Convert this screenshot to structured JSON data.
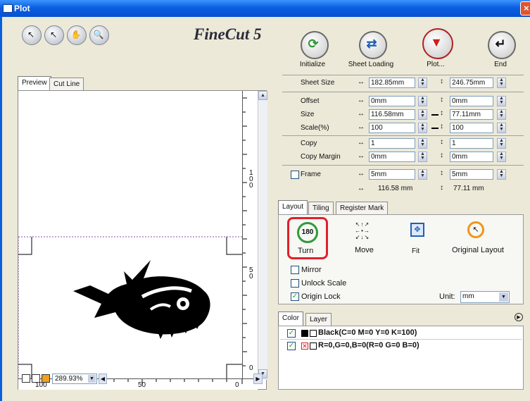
{
  "window": {
    "title": "Plot",
    "close": "×"
  },
  "toolbar": {
    "tools": [
      {
        "name": "select-tool",
        "glyph": "↖"
      },
      {
        "name": "pointer-tool",
        "glyph": "↖"
      },
      {
        "name": "hand-tool",
        "glyph": "✋"
      },
      {
        "name": "zoom-tool",
        "glyph": "🔍"
      }
    ],
    "logo": "FineCut 5"
  },
  "actions": {
    "initialize": "Initialize",
    "sheet_loading": "Sheet Loading",
    "plot": "Plot...",
    "end": "End"
  },
  "preview_tabs": [
    "Preview",
    "Cut Line"
  ],
  "rulers": {
    "right_marks": [
      "1",
      "0",
      "0",
      "5",
      "0",
      "0"
    ],
    "bottom_marks": [
      "100",
      "50",
      "0"
    ]
  },
  "zoom": "289.93%",
  "settings": {
    "sheet_size": {
      "label": "Sheet Size",
      "w": "182.85mm",
      "h": "246.75mm"
    },
    "offset": {
      "label": "Offset",
      "w": "0mm",
      "h": "0mm"
    },
    "size": {
      "label": "Size",
      "w": "116.58mm",
      "h": "77.11mm"
    },
    "scale": {
      "label": "Scale(%)",
      "w": "100",
      "h": "100"
    },
    "copy": {
      "label": "Copy",
      "w": "1",
      "h": "1"
    },
    "copy_margin": {
      "label": "Copy Margin",
      "w": "0mm",
      "h": "0mm"
    },
    "frame": {
      "label": "Frame",
      "w": "5mm",
      "h": "5mm"
    },
    "total": {
      "w": "116.58 mm",
      "h": "77.11 mm"
    }
  },
  "layout_tabs": [
    "Layout",
    "Tiling",
    "Register Mark"
  ],
  "layout": {
    "turn": "Turn",
    "turn_badge": "180",
    "move": "Move",
    "fit": "Fit",
    "original": "Original Layout",
    "mirror": "Mirror",
    "unlock_scale": "Unlock Scale",
    "origin_lock": "Origin Lock",
    "unit_label": "Unit:",
    "unit_value": "mm"
  },
  "color_tabs": [
    "Color",
    "Layer"
  ],
  "colors": [
    {
      "checked": "✓",
      "label": "Black(C=0 M=0 Y=0 K=100)"
    },
    {
      "checked": "✓",
      "label": "R=0,G=0,B=0(R=0 G=0 B=0)"
    }
  ],
  "accent": {
    "highlight": "#e0202a",
    "green": "#2f9a3a"
  }
}
